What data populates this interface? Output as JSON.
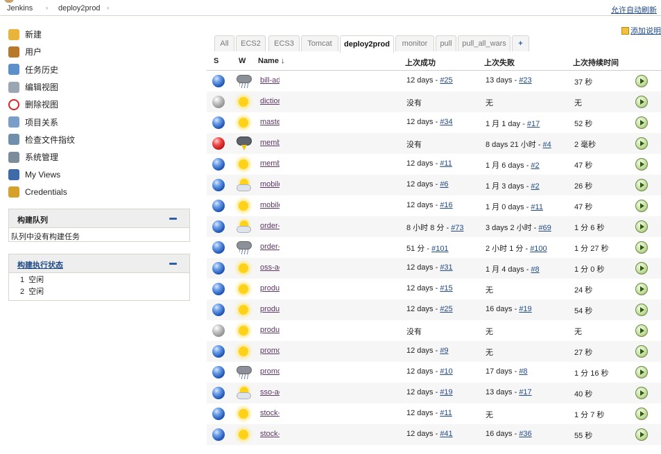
{
  "breadcrumb": [
    "Jenkins",
    "deploy2prod"
  ],
  "header": {
    "autorefresh": "允许自动刷新",
    "add_description": "添加说明"
  },
  "tasks": [
    {
      "label": "新建",
      "icon": "new-item-icon"
    },
    {
      "label": "用户",
      "icon": "people-icon"
    },
    {
      "label": "任务历史",
      "icon": "build-history-icon"
    },
    {
      "label": "编辑视图",
      "icon": "edit-view-icon"
    },
    {
      "label": "删除视图",
      "icon": "delete-view-icon"
    },
    {
      "label": "项目关系",
      "icon": "project-relationship-icon"
    },
    {
      "label": "检查文件指纹",
      "icon": "fingerprint-icon"
    },
    {
      "label": "系统管理",
      "icon": "manage-jenkins-icon"
    },
    {
      "label": "My Views",
      "icon": "my-views-icon"
    },
    {
      "label": "Credentials",
      "icon": "credentials-icon"
    }
  ],
  "build_queue": {
    "title": "构建队列",
    "empty": "队列中没有构建任务"
  },
  "executors": {
    "title": "构建执行状态",
    "rows": [
      {
        "num": "1",
        "status": "空闲"
      },
      {
        "num": "2",
        "status": "空闲"
      }
    ]
  },
  "tabs": [
    "All",
    "ECS2",
    "ECS3",
    "Tomcat",
    "deploy2prod",
    "monitor",
    "pull",
    "pull_all_wars",
    "+"
  ],
  "active_tab": "deploy2prod",
  "columns": {
    "s": "S",
    "w": "W",
    "name": "Name ↓",
    "last_success": "上次成功",
    "last_failure": "上次失败",
    "last_duration": "上次持续时间"
  },
  "jobs": [
    {
      "status": "blue",
      "weather": "rain",
      "name": "bill-ad",
      "succ": "12 days - ",
      "succ_link": "#25",
      "fail": "13 days - ",
      "fail_link": "#23",
      "dur": "37 秒"
    },
    {
      "status": "grey",
      "weather": "sunny",
      "name": "diction",
      "succ": "没有",
      "succ_link": "",
      "fail": "无",
      "fail_link": "",
      "dur": "无"
    },
    {
      "status": "blue",
      "weather": "sunny",
      "name": "maste",
      "succ": "12 days - ",
      "succ_link": "#34",
      "fail": "1 月 1 day - ",
      "fail_link": "#17",
      "dur": "52 秒"
    },
    {
      "status": "red",
      "weather": "storm",
      "name": "memb",
      "succ": "没有",
      "succ_link": "",
      "fail": "8 days 21 小时 - ",
      "fail_link": "#4",
      "dur": "2 毫秒"
    },
    {
      "status": "blue",
      "weather": "sunny",
      "name": "memb",
      "succ": "12 days - ",
      "succ_link": "#11",
      "fail": "1 月 6 days - ",
      "fail_link": "#2",
      "dur": "47 秒"
    },
    {
      "status": "blue",
      "weather": "partly",
      "name": "mobile",
      "succ": "12 days - ",
      "succ_link": "#6",
      "fail": "1 月 3 days - ",
      "fail_link": "#2",
      "dur": "26 秒"
    },
    {
      "status": "blue",
      "weather": "sunny",
      "name": "mobile",
      "succ": "12 days - ",
      "succ_link": "#16",
      "fail": "1 月 0 days - ",
      "fail_link": "#11",
      "dur": "47 秒"
    },
    {
      "status": "blue",
      "weather": "partly",
      "name": "order-",
      "succ": "8 小时 8 分 - ",
      "succ_link": "#73",
      "fail": "3 days 2 小时 - ",
      "fail_link": "#69",
      "dur": "1 分 6 秒"
    },
    {
      "status": "blue",
      "weather": "rain",
      "name": "order-i",
      "succ": "51 分 - ",
      "succ_link": "#101",
      "fail": "2 小时 1 分 - ",
      "fail_link": "#100",
      "dur": "1 分 27 秒"
    },
    {
      "status": "blue",
      "weather": "sunny",
      "name": "oss-ac",
      "succ": "12 days - ",
      "succ_link": "#31",
      "fail": "1 月 4 days - ",
      "fail_link": "#8",
      "dur": "1 分 0 秒"
    },
    {
      "status": "blue",
      "weather": "sunny",
      "name": "produ",
      "succ": "12 days - ",
      "succ_link": "#15",
      "fail": "无",
      "fail_link": "",
      "dur": "24 秒"
    },
    {
      "status": "blue",
      "weather": "sunny",
      "name": "produ",
      "succ": "12 days - ",
      "succ_link": "#25",
      "fail": "16 days - ",
      "fail_link": "#19",
      "dur": "54 秒"
    },
    {
      "status": "grey",
      "weather": "sunny",
      "name": "produ",
      "succ": "没有",
      "succ_link": "",
      "fail": "无",
      "fail_link": "",
      "dur": "无"
    },
    {
      "status": "blue",
      "weather": "sunny",
      "name": "promo",
      "succ": "12 days - ",
      "succ_link": "#9",
      "fail": "无",
      "fail_link": "",
      "dur": "27 秒"
    },
    {
      "status": "blue",
      "weather": "rain",
      "name": "promo",
      "succ": "12 days - ",
      "succ_link": "#10",
      "fail": "17 days - ",
      "fail_link": "#8",
      "dur": "1 分 16 秒"
    },
    {
      "status": "blue",
      "weather": "partly",
      "name": "sso-ac",
      "succ": "12 days - ",
      "succ_link": "#19",
      "fail": "13 days - ",
      "fail_link": "#17",
      "dur": "40 秒"
    },
    {
      "status": "blue",
      "weather": "sunny",
      "name": "stock-",
      "succ": "12 days - ",
      "succ_link": "#11",
      "fail": "无",
      "fail_link": "",
      "dur": "1 分 7 秒"
    },
    {
      "status": "blue",
      "weather": "sunny",
      "name": "stock-",
      "succ": "12 days - ",
      "succ_link": "#41",
      "fail": "16 days - ",
      "fail_link": "#36",
      "dur": "55 秒"
    }
  ]
}
